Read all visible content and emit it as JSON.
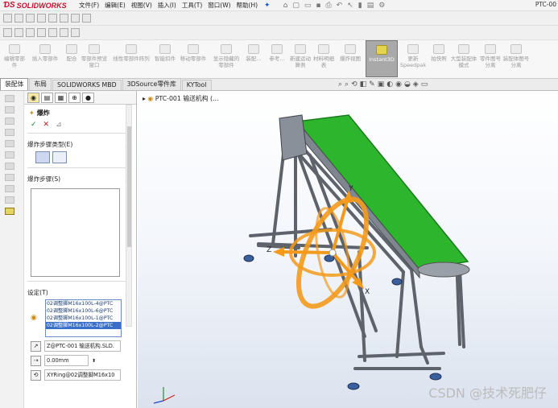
{
  "app": {
    "logo": "SOLIDWORKS",
    "doc_title": "PTC-00"
  },
  "menu": [
    "文件(F)",
    "编辑(E)",
    "视图(V)",
    "插入(I)",
    "工具(T)",
    "窗口(W)",
    "帮助(H)"
  ],
  "ribbon": [
    "编辑零部件",
    "插入零部件",
    "配合",
    "零部件预览窗口",
    "线性零部件阵列",
    "智能扣件",
    "移动零部件",
    "显示隐藏的零部件",
    "装配...",
    "参考...",
    "新建运动算例",
    "材料明细表",
    "爆炸视图",
    "Instant3D",
    "更新Speedpak",
    "拍快照",
    "大型装配体模式",
    "零件图号分离",
    "装配体图号分离"
  ],
  "ribbon_active": "Instant3D",
  "tabs": [
    "装配体",
    "布局",
    "SOLIDWORKS MBD",
    "3DSource零件库",
    "KYTool"
  ],
  "tab_active": "装配体",
  "tree_label": "PTC-001 输送机构 (...",
  "property_manager": {
    "title": "爆炸",
    "help": "?",
    "ok": "✓",
    "cancel": "✕",
    "step_type_label": "爆炸步骤类型(E)",
    "steps_label": "爆炸步骤(S)",
    "settings_label": "设定(T)",
    "components": [
      "02调整脚M16x100L-4@PTC",
      "02调整脚M16x100L-6@PTC",
      "02调整脚M16x100L-1@PTC",
      "02调整脚M16x100L-2@PTC"
    ],
    "direction_ref": "Z@PTC-001 输送机构.SLD.",
    "distance": "0.00mm",
    "rotation_ref": "XYRing@02调整脚M16x10"
  },
  "triad": {
    "x": "X",
    "y": "Y",
    "z": "Z"
  },
  "watermark": "CSDN @技术死肥仔",
  "colors": {
    "belt": "#2db52d",
    "handle": "#f39a1c",
    "frame": "#6a6f78"
  }
}
